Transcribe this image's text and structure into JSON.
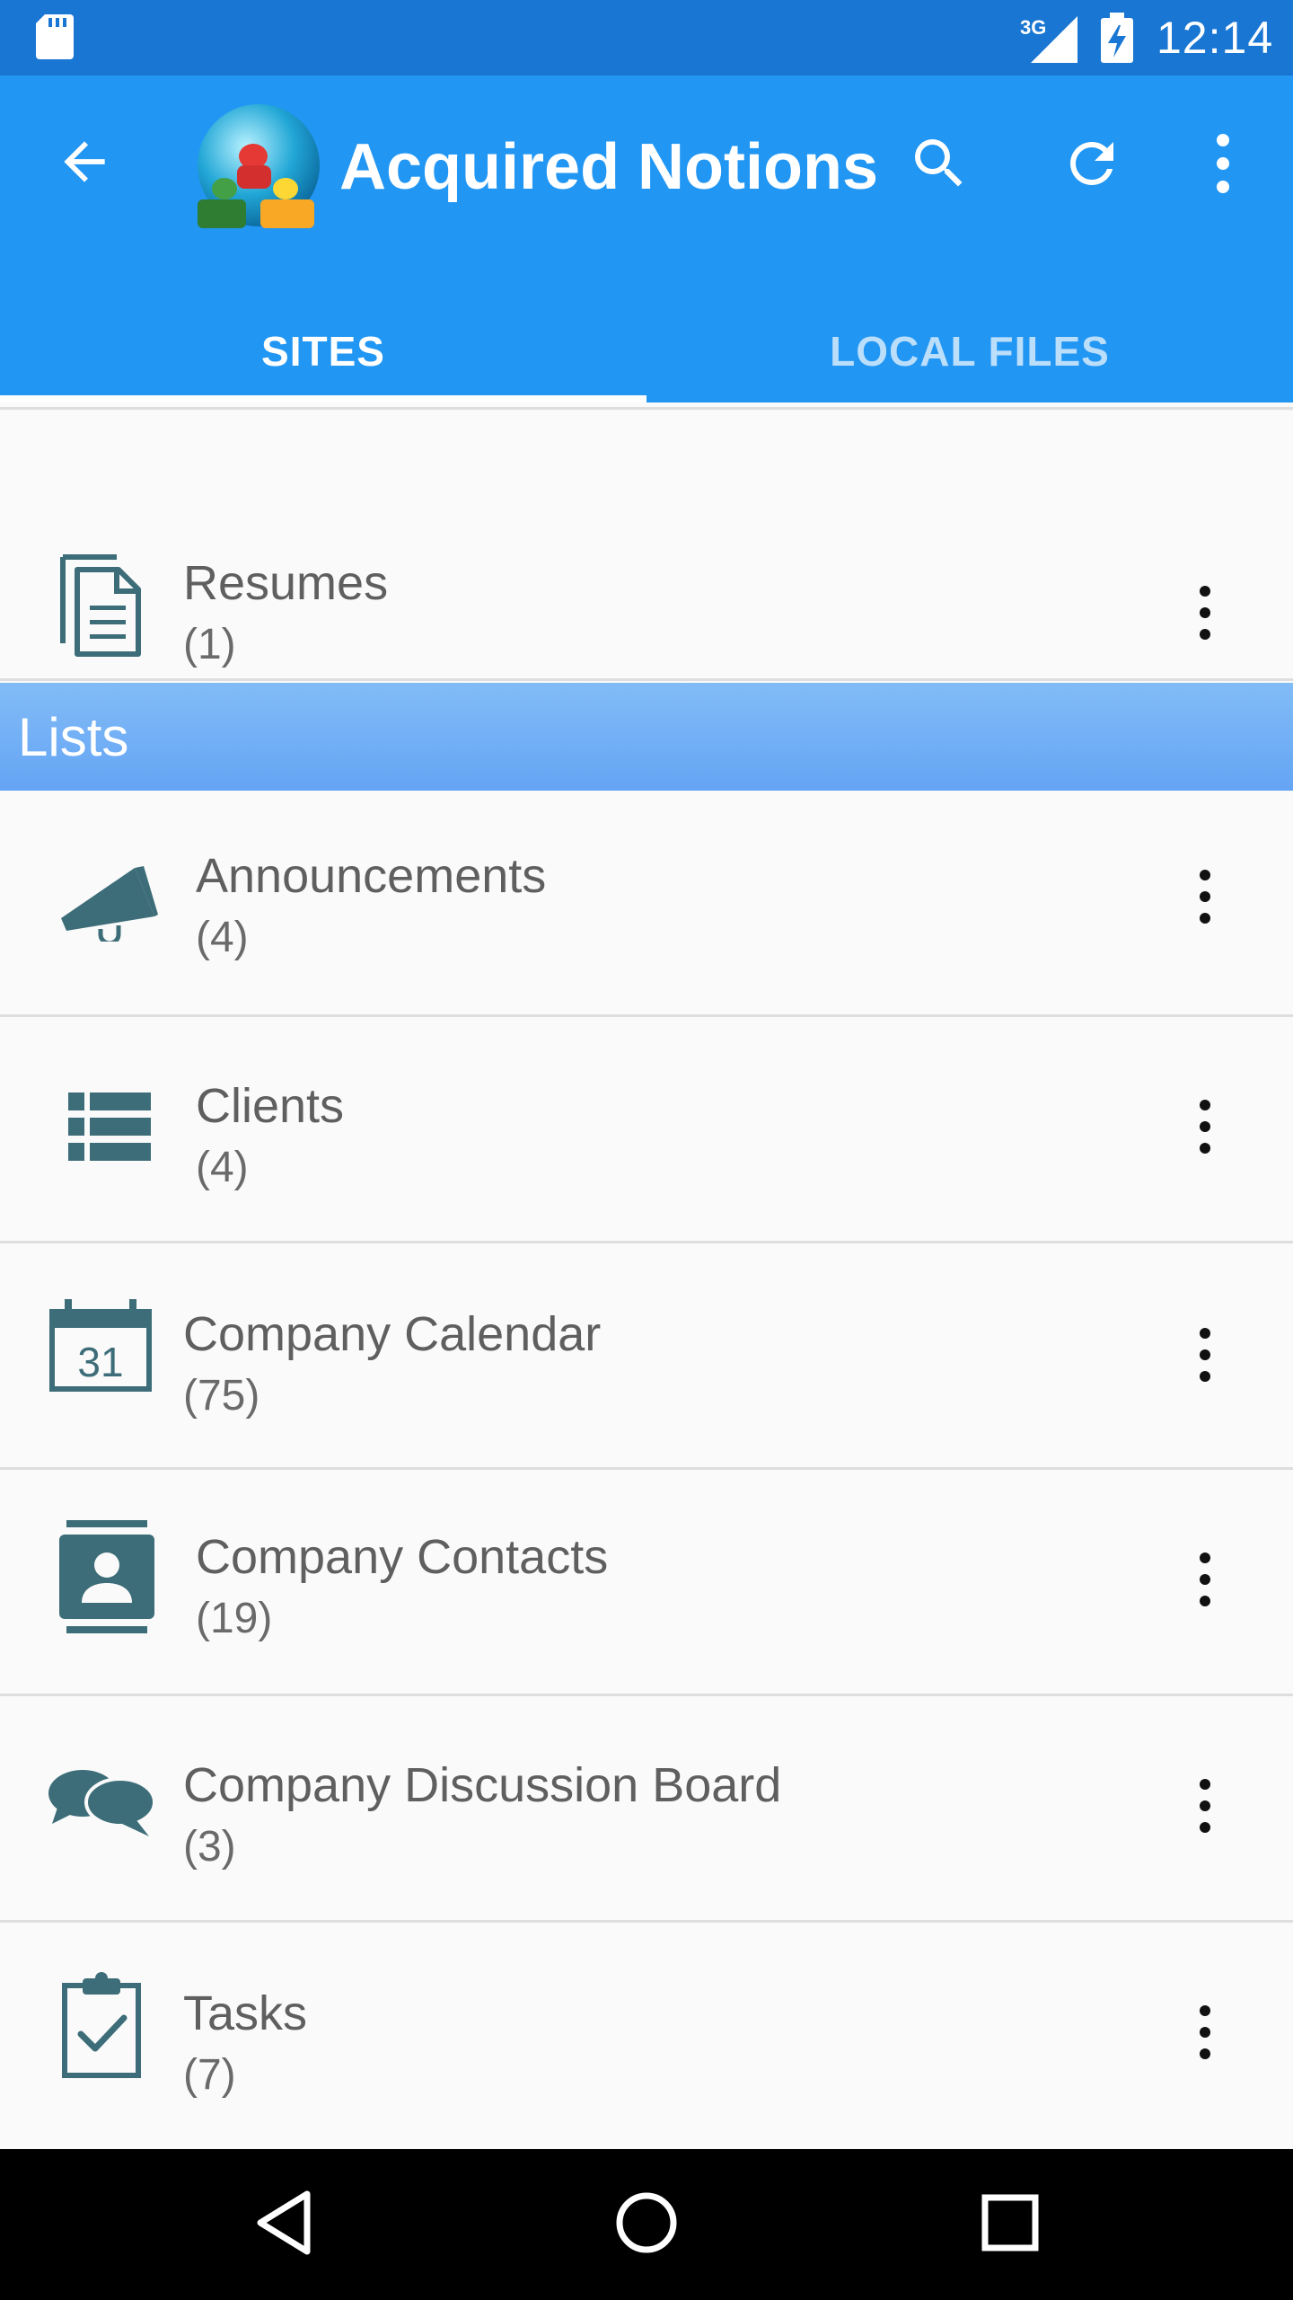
{
  "status_bar": {
    "time": "12:14",
    "network": "3G"
  },
  "app_bar": {
    "title": "Acquired Notions"
  },
  "tabs": [
    {
      "label": "SITES"
    },
    {
      "label": "LOCAL FILES"
    }
  ],
  "libraries": [
    {
      "name": "Resumes",
      "count": "(1)",
      "icon": "document-icon"
    }
  ],
  "section_header": "Lists",
  "lists": [
    {
      "name": "Announcements",
      "count": "(4)",
      "icon": "megaphone-icon"
    },
    {
      "name": "Clients",
      "count": "(4)",
      "icon": "list-icon"
    },
    {
      "name": "Company Calendar",
      "count": "(75)",
      "icon": "calendar-icon",
      "calendar_day": "31"
    },
    {
      "name": "Company Contacts",
      "count": "(19)",
      "icon": "contacts-icon"
    },
    {
      "name": "Company Discussion Board",
      "count": "(3)",
      "icon": "chat-bubbles-icon"
    },
    {
      "name": "Tasks",
      "count": "(7)",
      "icon": "clipboard-check-icon"
    }
  ],
  "colors": {
    "status_bar": "#1976d2",
    "app_bar": "#2196f3",
    "icon_teal": "#3d6d78",
    "section_header": "#6fb0f5"
  }
}
